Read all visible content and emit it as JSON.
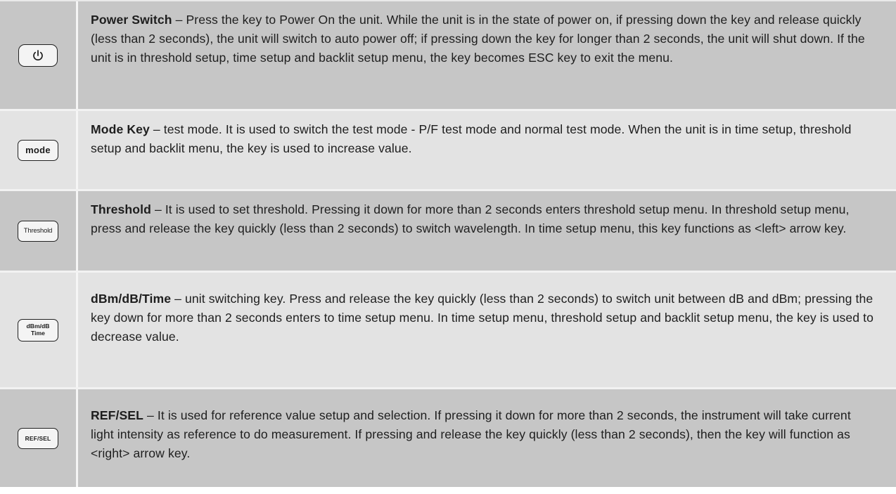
{
  "rows": [
    {
      "key_label": "",
      "key_icon": "power-icon",
      "title": "Power Switch",
      "description": " – Press the key to Power On the unit. While the unit is in the state of power on, if pressing down the key and release quickly (less than 2 seconds), the unit will switch to auto power off; if pressing down the key for longer than 2 seconds, the unit will shut down. If the unit is in threshold setup, time setup and backlit setup menu, the key becomes ESC key to exit the menu."
    },
    {
      "key_label": "mode",
      "title": "Mode Key",
      "description": " – test mode. It is used to switch the test mode - P/F test mode and normal test mode. When the unit is in time setup, threshold setup and backlit menu, the key is used to increase value."
    },
    {
      "key_label": "Threshold",
      "title": "Threshold",
      "description": " – It is used to set threshold. Pressing it down for more than 2 seconds enters threshold setup menu. In threshold setup menu, press and release the key quickly (less than 2 seconds) to switch wavelength. In time setup menu, this key functions as <left> arrow key."
    },
    {
      "key_label": "dBm/dB\nTime",
      "title": "dBm/dB/Time",
      "description": " – unit switching key. Press and release the key quickly (less than 2 seconds) to switch unit between dB and dBm; pressing the key down for more than 2 seconds enters to time setup menu. In time setup menu, threshold setup and backlit setup menu, the key is used to decrease value."
    },
    {
      "key_label": "REF/SEL",
      "title": "REF/SEL",
      "description": " – It is used for reference value setup and selection. If pressing it down for more than 2 seconds, the instrument will take current light intensity as reference to do measurement. If pressing and release the key quickly (less than 2 seconds), then the key will function as <right> arrow key."
    }
  ],
  "colors": {
    "row_dark": "#c6c6c6",
    "row_light": "#e3e3e3",
    "text": "#1e1e1e"
  }
}
